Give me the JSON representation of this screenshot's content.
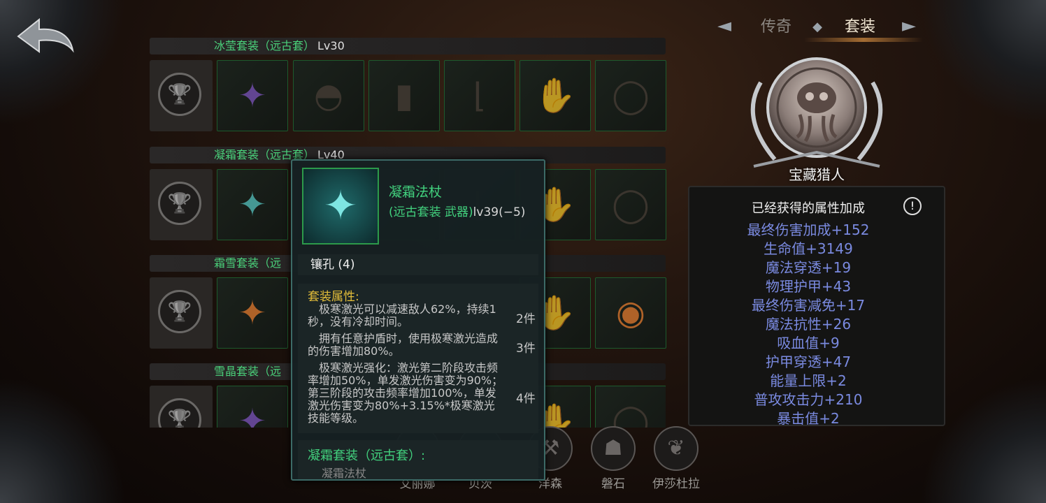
{
  "nav": {
    "tabs": [
      {
        "label": "传奇"
      },
      {
        "label": "套装"
      }
    ]
  },
  "sets": [
    {
      "name": "冰莹套装（远古套）",
      "level": "Lv30"
    },
    {
      "name": "凝霜套装（远古套）",
      "level": "Lv40"
    },
    {
      "name": "霜雪套装（远",
      "level": ""
    },
    {
      "name": "雪晶套装（远",
      "level": ""
    }
  ],
  "emblem": {
    "name": "宝藏猎人"
  },
  "stats": {
    "title": "已经获得的属性加成",
    "info_icon": "!",
    "items": [
      {
        "name": "最终伤害加成",
        "value": "+152"
      },
      {
        "name": "生命值",
        "value": "+3149"
      },
      {
        "name": "魔法穿透",
        "value": "+19"
      },
      {
        "name": "物理护甲",
        "value": "+43"
      },
      {
        "name": "最终伤害减免",
        "value": "+17"
      },
      {
        "name": "魔法抗性",
        "value": "+26"
      },
      {
        "name": "吸血值",
        "value": "+9"
      },
      {
        "name": "护甲穿透",
        "value": "+47"
      },
      {
        "name": "能量上限",
        "value": "+2"
      },
      {
        "name": "普攻攻击力",
        "value": "+210"
      },
      {
        "name": "暴击值",
        "value": "+2"
      }
    ]
  },
  "heroes": [
    {
      "label": "艾丽娜"
    },
    {
      "label": "贝茨"
    },
    {
      "label": "洋森"
    },
    {
      "label": "磐石"
    },
    {
      "label": "伊莎杜拉"
    }
  ],
  "tooltip": {
    "item_name": "凝霜法杖",
    "sub_prefix": "(远古套装 武器)",
    "sub_level": "lv39(−5)",
    "socket": "镶孔 (4)",
    "set_title": "套装属性:",
    "effects": [
      {
        "text": "极寒激光可以减速敌人62%，持续1秒，没有冷却时间。",
        "count": "2件"
      },
      {
        "text": "拥有任意护盾时，使用极寒激光造成的伤害增加80%。",
        "count": "3件"
      },
      {
        "text": "极寒激光强化：激光第二阶段攻击频率增加50%，单发激光伤害变为90%；第三阶段的攻击频率增加100%，单发激光伤害变为80%+3.15%*极寒激光技能等级。",
        "count": "4件"
      }
    ],
    "footer_title": "凝霜套装（远古套）:",
    "footer_item": "凝霜法杖"
  },
  "colors": {
    "set_name": "#4ad07a",
    "stat_text": "#7a8ae0",
    "set_title": "#e5bf3a",
    "item_border": "#1d5a2d"
  },
  "icons": {
    "back": "back-arrow-icon",
    "trophy": "trophy-icon",
    "tab_diamond": "diamond-icon"
  }
}
